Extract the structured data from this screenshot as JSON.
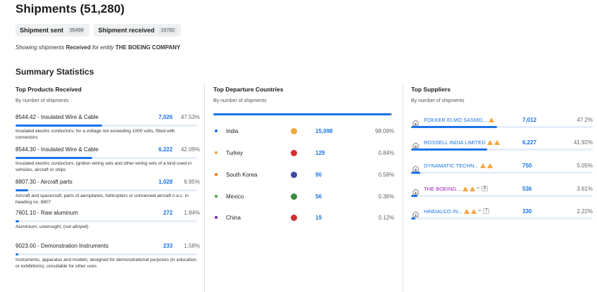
{
  "header": {
    "title": "Shipments (51,280)",
    "tabs": [
      {
        "label": "Shipment sent",
        "count": "35498"
      },
      {
        "label": "Shipment received",
        "count": "15782"
      }
    ],
    "showing_prefix": "Showing shipments",
    "showing_mode": "Received",
    "showing_mid": "for entity",
    "showing_entity": "THE BOEING COMPANY"
  },
  "summary_title": "Summary Statistics",
  "products": {
    "title": "Top Products Received",
    "subtitle": "By number of shipments",
    "items": [
      {
        "name": "8544.42 - Insulated Wire & Cable",
        "value": "7,026",
        "pct": "47.53%",
        "share": 0.4753,
        "desc": "Insulated electric conductors; for a voltage not exceeding 1000 volts, fitted with connectors"
      },
      {
        "name": "8544.30 - Insulated Wire & Cable",
        "value": "6,222",
        "pct": "42.09%",
        "share": 0.4209,
        "desc": "Insulated electric conductors; ignition wiring sets and other wiring sets of a kind used in vehicles, aircraft or ships"
      },
      {
        "name": "8807.30 - Aircraft parts",
        "value": "1,028",
        "pct": "6.95%",
        "share": 0.0695,
        "desc": "Aircraft and spacecraft; parts of aeroplanes, helicopters or unmanned aircraft n.e.c. in heading no. 8807"
      },
      {
        "name": "7601.10 - Raw aluminum",
        "value": "272",
        "pct": "1.84%",
        "share": 0.0184,
        "desc": "Aluminium; unwrought, (not alloyed)"
      },
      {
        "name": "9023.00 - Demonstration Instruments",
        "value": "233",
        "pct": "1.58%",
        "share": 0.0158,
        "desc": "Instruments, apparatus and models; designed for demonstrational purposes (in education or exhibitions), unsuitable for other uses"
      }
    ]
  },
  "countries": {
    "title": "Top Departure Countries",
    "subtitle": "By number of shipments",
    "items": [
      {
        "name": "India",
        "value": "15,098",
        "pct": "98.09%",
        "dot": "#1a73e8",
        "flag": "#f4a640"
      },
      {
        "name": "Turkey",
        "value": "129",
        "pct": "0.84%",
        "dot": "#f4a640",
        "flag": "#d32f2f"
      },
      {
        "name": "South Korea",
        "value": "90",
        "pct": "0.58%",
        "dot": "#e8710a",
        "flag": "#3949ab"
      },
      {
        "name": "Mexico",
        "value": "56",
        "pct": "0.36%",
        "dot": "#43a047",
        "flag": "#388e3c"
      },
      {
        "name": "China",
        "value": "19",
        "pct": "0.12%",
        "dot": "#7b1fa2",
        "flag": "#d32f2f"
      }
    ]
  },
  "suppliers": {
    "title": "Top Suppliers",
    "subtitle": "By number of shipments",
    "items": [
      {
        "name": "FOKKER ELMO SASMO...",
        "value": "7,012",
        "pct": "47.2%",
        "share": 0.472,
        "warnings": 1,
        "badge": ""
      },
      {
        "name": "ROSSELL INDIA LIMITED",
        "value": "6,227",
        "pct": "41.92%",
        "share": 0.4192,
        "warnings": 2,
        "badge": ""
      },
      {
        "name": "DYNAMATIC TECHN...",
        "value": "750",
        "pct": "5.05%",
        "share": 0.0505,
        "warnings": 2,
        "badge": ""
      },
      {
        "name": "THE BOEING...",
        "value": "536",
        "pct": "3.61%",
        "share": 0.0361,
        "warnings": 2,
        "badge": "8"
      },
      {
        "name": "HINDALCO IN...",
        "value": "330",
        "pct": "2.22%",
        "share": 0.0222,
        "warnings": 2,
        "badge": "7"
      }
    ]
  }
}
